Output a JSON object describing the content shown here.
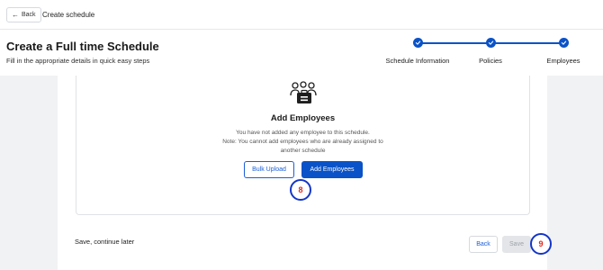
{
  "topbar": {
    "back_label": "Back",
    "breadcrumb": "Create schedule"
  },
  "header": {
    "title": "Create a Full time Schedule",
    "subtitle": "Fill in the appropriate details in quick easy steps"
  },
  "steps": [
    {
      "label": "Schedule Information",
      "state": "completed"
    },
    {
      "label": "Policies",
      "state": "completed"
    },
    {
      "label": "Employees",
      "state": "current"
    }
  ],
  "card": {
    "icon": "employees-icon",
    "title": "Add Employees",
    "line1": "You have not added any employee to this schedule.",
    "line2": "Note: You cannot add employees who are already assigned to",
    "line3": "another schedule",
    "bulk_upload_label": "Bulk Upload",
    "add_employees_label": "Add Employees"
  },
  "annotations": {
    "badge_a": "8",
    "badge_b": "9"
  },
  "footer": {
    "save_later": "Save, continue later",
    "back_label": "Back",
    "save_label": "Save"
  },
  "colors": {
    "primary": "#0a52c7",
    "badge_border": "#1436c8",
    "badge_text": "#e0291f",
    "disabled_bg": "#e3e5e8"
  }
}
